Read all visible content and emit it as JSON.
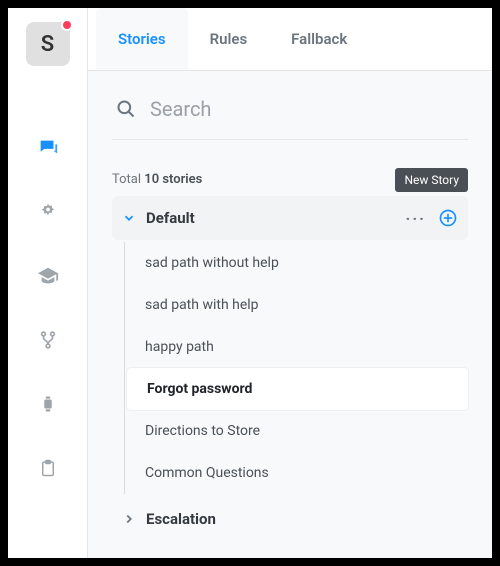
{
  "logo": {
    "letter": "S"
  },
  "tabs": {
    "stories": "Stories",
    "rules": "Rules",
    "fallback": "Fallback"
  },
  "search": {
    "placeholder": "Search"
  },
  "total": {
    "prefix": "Total ",
    "count": "10 stories"
  },
  "tooltip": {
    "new_story": "New Story"
  },
  "groups": {
    "default": {
      "name": "Default"
    },
    "escalation": {
      "name": "Escalation"
    }
  },
  "stories": [
    "sad path without help",
    "sad path with help",
    "happy path",
    "Forgot password",
    "Directions to Store",
    "Common Questions"
  ]
}
